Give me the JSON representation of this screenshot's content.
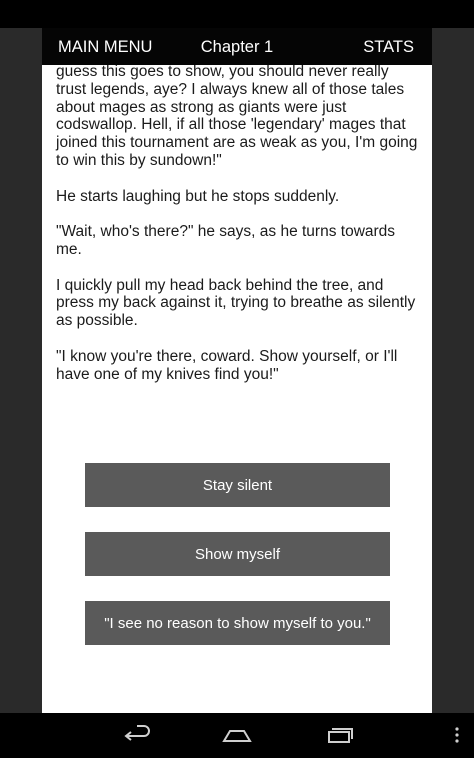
{
  "header": {
    "menu_label": "MAIN MENU",
    "title": "Chapter 1",
    "stats_label": "STATS"
  },
  "story": {
    "paragraphs": [
      "guess this goes to show, you should never really trust legends, aye? I always knew all of those tales about mages as strong as giants were just codswallop. Hell, if all those 'legendary' mages that joined this tournament are as weak as you, I'm going to win this by sundown!\"",
      "He starts laughing but he stops suddenly.",
      "\"Wait, who's there?\" he says, as he turns towards me.",
      "I quickly pull my head back behind the tree, and press my back against it, trying to breathe as silently as possible.",
      "\"I know you're there, coward. Show yourself, or I'll have one of my knives find you!\""
    ]
  },
  "choices": [
    {
      "label": "Stay silent"
    },
    {
      "label": "Show myself"
    },
    {
      "label": "\"I see no reason to show myself to you.\""
    }
  ],
  "nav": {
    "icons": [
      "back-icon",
      "home-icon",
      "recent-apps-icon",
      "overflow-menu-icon"
    ]
  },
  "colors": {
    "button_bg": "#5a5a5a",
    "title_bar_bg": "#050505",
    "content_bg": "#ffffff",
    "frame_bg": "#2a2a2a"
  }
}
